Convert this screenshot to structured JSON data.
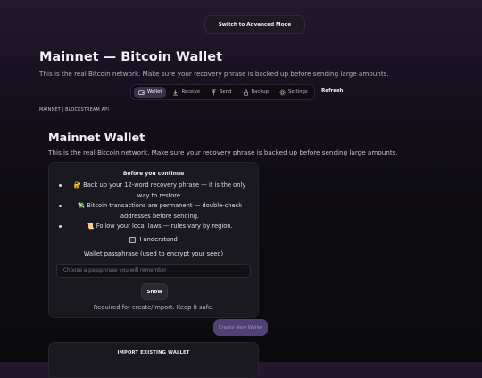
{
  "header": {
    "advanced_mode_label": "Switch to Advanced Mode",
    "title": "Mainnet — Bitcoin Wallet",
    "subtitle": "This is the real Bitcoin network. Make sure your recovery phrase is backed up before sending large amounts."
  },
  "nav": {
    "tabs": [
      {
        "label": "Wallet",
        "icon": "wallet-icon",
        "active": true
      },
      {
        "label": "Receive",
        "icon": "receive-icon",
        "active": false
      },
      {
        "label": "Send",
        "icon": "send-icon",
        "active": false
      },
      {
        "label": "Backup",
        "icon": "backup-icon",
        "active": false
      },
      {
        "label": "Settings",
        "icon": "settings-icon",
        "active": false
      }
    ],
    "refresh_label": "Refresh"
  },
  "network_line": "MAINNET | BLOCKSTREAM API",
  "wallet": {
    "title": "Mainnet Wallet",
    "subtitle": "This is the real Bitcoin network. Make sure your recovery phrase is backed up before sending large amounts."
  },
  "before_card": {
    "heading": "Before you continue",
    "bullets": [
      "🔐 Back up your 12-word recovery phrase — it is the only way to restore.",
      "💸 Bitcoin transactions are permanent — double-check addresses before sending.",
      "📜 Follow your local laws — rules vary by region."
    ],
    "understand_label": "I understand",
    "understand_checked": false,
    "passphrase_label": "Wallet passphrase (used to encrypt your seed)",
    "passphrase_placeholder": "Choose a passphrase you will remember",
    "passphrase_value": "",
    "show_label": "Show",
    "hint": "Required for create/import. Keep it safe."
  },
  "create_button_label": "Create New Wallet",
  "import_card": {
    "title": "IMPORT EXISTING WALLET"
  },
  "colors": {
    "accent": "#4f4173",
    "active_tab": "#3a304c",
    "card_bg": "#1a1920"
  }
}
